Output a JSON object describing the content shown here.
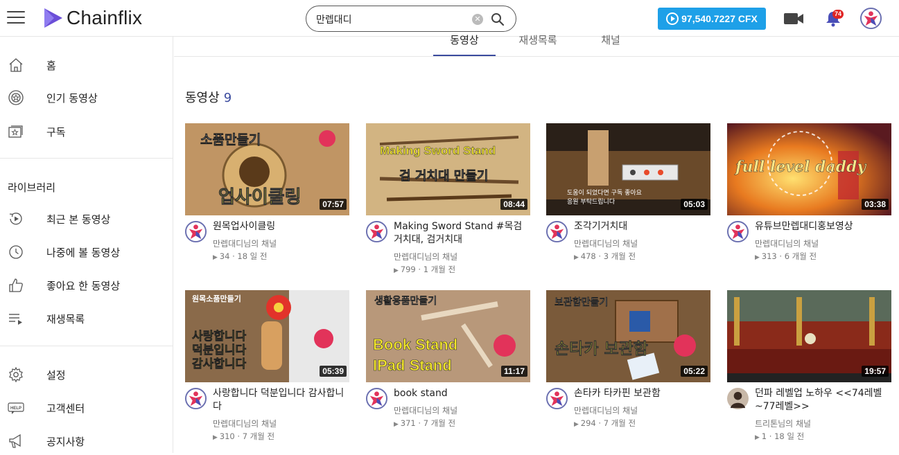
{
  "app": {
    "name": "Chainflix"
  },
  "search": {
    "value": "만렙대디",
    "clear_glyph": "✕"
  },
  "wallet": {
    "balance": "97,540.7227 CFX"
  },
  "notifications": {
    "count": "74"
  },
  "sidebar": {
    "items": [
      {
        "label": "홈",
        "icon": "home-icon"
      },
      {
        "label": "인기 동영상",
        "icon": "trending-icon"
      },
      {
        "label": "구독",
        "icon": "subscriptions-icon"
      }
    ],
    "library_heading": "라이브러리",
    "library_items": [
      {
        "label": "최근 본 동영상",
        "icon": "history-icon"
      },
      {
        "label": "나중에 볼 동영상",
        "icon": "watch-later-icon"
      },
      {
        "label": "좋아요 한 동영상",
        "icon": "like-icon"
      },
      {
        "label": "재생목록",
        "icon": "playlist-icon"
      }
    ],
    "footer_items": [
      {
        "label": "설정",
        "icon": "settings-icon"
      },
      {
        "label": "고객센터",
        "icon": "help-icon"
      },
      {
        "label": "공지사항",
        "icon": "megaphone-icon"
      }
    ]
  },
  "tabs": [
    {
      "label": "동영상",
      "active": true
    },
    {
      "label": "재생목록",
      "active": false
    },
    {
      "label": "채널",
      "active": false
    }
  ],
  "section": {
    "title": "동영상",
    "count": "9"
  },
  "videos": [
    {
      "title": "원목업사이클링",
      "channel": "만렙대디님의 채널",
      "meta": "34 · 18 일 전",
      "duration": "07:57",
      "thumb_text": "소품만들기",
      "thumb_text2": "업사이클링"
    },
    {
      "title": "Making Sword Stand #목검거치대, 검거치대",
      "channel": "만렙대디님의 채널",
      "meta": "799 · 1 개월 전",
      "duration": "08:44",
      "thumb_text": "Making Sword Stand",
      "thumb_text2": "검 거치대 만들기"
    },
    {
      "title": "조각기거치대",
      "channel": "만렙대디님의 채널",
      "meta": "478 · 3 개월 전",
      "duration": "05:03",
      "thumb_text": "도움이 되었다면 구독 좋아요",
      "thumb_text2": "응원 부탁드립니다"
    },
    {
      "title": "유튜브만렙대디홍보영상",
      "channel": "만렙대디님의 채널",
      "meta": "313 · 6 개월 전",
      "duration": "03:38",
      "thumb_text": "full level daddy",
      "thumb_text2": ""
    },
    {
      "title": "사랑합니다 덕분입니다 감사합니다",
      "channel": "만렙대디님의 채널",
      "meta": "310 · 7 개월 전",
      "duration": "05:39",
      "thumb_text": "원목소품만들기",
      "thumb_text2": "사랑합니다 덕분입니다 감사합니다"
    },
    {
      "title": "book stand",
      "channel": "만렙대디님의 채널",
      "meta": "371 · 7 개월 전",
      "duration": "11:17",
      "thumb_text": "생활용품만들기",
      "thumb_text2": "Book Stand IPad Stand"
    },
    {
      "title": "손타카 타카핀 보관함",
      "channel": "만렙대디님의 채널",
      "meta": "294 · 7 개월 전",
      "duration": "05:22",
      "thumb_text": "보관함만들기",
      "thumb_text2": "손타카 보관함"
    },
    {
      "title": "던파 레벨업 노하우 <<74레벨~77레벨>>",
      "channel": "트리톤님의 채널",
      "meta": "1 · 18 일 전",
      "duration": "19:57",
      "thumb_text": "",
      "thumb_text2": ""
    }
  ],
  "colors": {
    "accent": "#3a4a9e",
    "cfx_button": "#1ea0e8",
    "badge": "#e02424",
    "logo": "#6b4fd8"
  }
}
